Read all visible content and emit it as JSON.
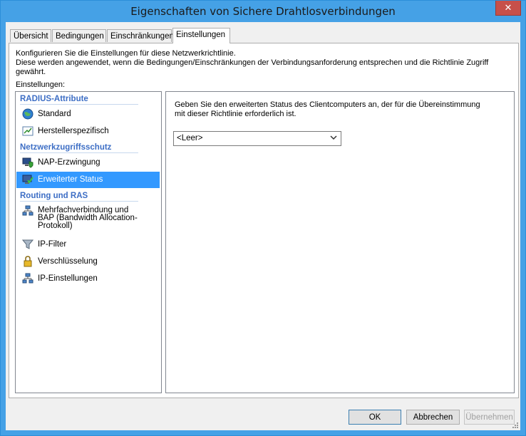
{
  "window": {
    "title": "Eigenschaften von Sichere Drahtlosverbindungen",
    "close_symbol": "✕"
  },
  "tabs": [
    {
      "label": "Übersicht"
    },
    {
      "label": "Bedingungen"
    },
    {
      "label": "Einschränkungen"
    },
    {
      "label": "Einstellungen"
    }
  ],
  "panel": {
    "desc_line1": "Konfigurieren Sie die Einstellungen für diese Netzwerkrichtlinie.",
    "desc_line2": "Diese werden angewendet, wenn die Bedingungen/Einschränkungen der Verbindungsanforderung entsprechen und die Richtlinie Zugriff gewährt.",
    "settings_label": "Einstellungen:"
  },
  "nav": {
    "sections": [
      {
        "title": "RADIUS-Attribute"
      },
      {
        "title": "Netzwerkzugriffsschutz"
      },
      {
        "title": "Routing und RAS"
      }
    ],
    "items": [
      {
        "label": "Standard",
        "icon": "globe-icon"
      },
      {
        "label": "Herstellerspezifisch",
        "icon": "chart-icon"
      },
      {
        "label": "NAP-Erzwingung",
        "icon": "computer-shield-icon"
      },
      {
        "label": "Erweiterter Status",
        "icon": "computer-check-icon",
        "selected": true
      },
      {
        "label_lines": [
          "Mehrfachverbindung und",
          "BAP (Bandwidth Allocation-",
          "Protokoll)"
        ],
        "icon": "network-icon"
      },
      {
        "label": "IP-Filter",
        "icon": "filter-icon"
      },
      {
        "label": "Verschlüsselung",
        "icon": "lock-icon"
      },
      {
        "label": "IP-Einstellungen",
        "icon": "network-icon"
      }
    ]
  },
  "detail": {
    "text_line1": "Geben Sie den erweiterten Status des Clientcomputers an, der für die Übereinstimmung",
    "text_line2": "mit dieser Richtlinie erforderlich ist.",
    "combo_value": "<Leer>"
  },
  "buttons": {
    "ok": "OK",
    "cancel": "Abbrechen",
    "apply": "Übernehmen"
  },
  "colors": {
    "titlebar": "#45a1e6",
    "close": "#c7504a",
    "selection": "#3399ff",
    "section_text": "#3d6ec5"
  }
}
